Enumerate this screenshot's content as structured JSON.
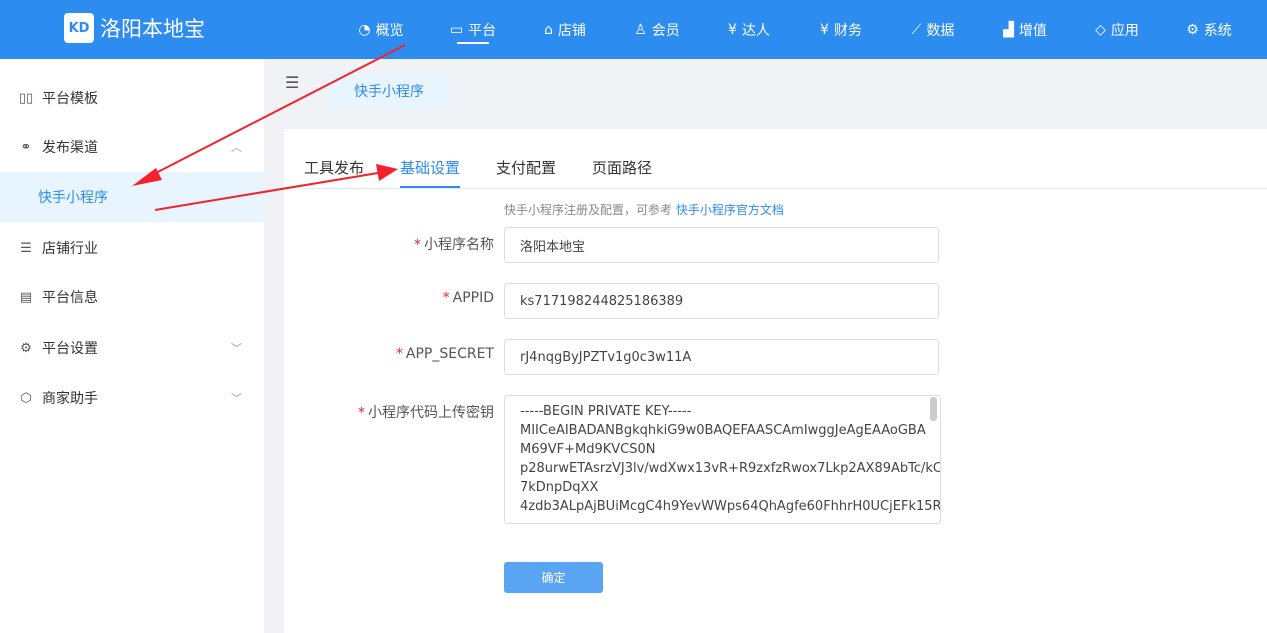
{
  "app": {
    "logo_mark": "KD",
    "title": "洛阳本地宝"
  },
  "nav": [
    {
      "label": "概览",
      "icon": "dashboard-icon"
    },
    {
      "label": "平台",
      "icon": "monitor-icon"
    },
    {
      "label": "店铺",
      "icon": "shop-icon"
    },
    {
      "label": "会员",
      "icon": "user-icon"
    },
    {
      "label": "达人",
      "icon": "yen-card-icon"
    },
    {
      "label": "财务",
      "icon": "finance-icon"
    },
    {
      "label": "数据",
      "icon": "line-chart-icon"
    },
    {
      "label": "增值",
      "icon": "growth-icon"
    },
    {
      "label": "应用",
      "icon": "cube-icon"
    },
    {
      "label": "系统",
      "icon": "gear-icon"
    }
  ],
  "sidebar": {
    "items": [
      {
        "label": "平台模板",
        "icon": "template-icon"
      },
      {
        "label": "发布渠道",
        "icon": "channel-icon"
      },
      {
        "label": "店铺行业",
        "icon": "list-icon"
      },
      {
        "label": "平台信息",
        "icon": "info-icon"
      },
      {
        "label": "平台设置",
        "icon": "settings-icon"
      },
      {
        "label": "商家助手",
        "icon": "helper-icon"
      }
    ],
    "sub_active": "快手小程序"
  },
  "page_tab": "快手小程序",
  "tabs": [
    "工具发布",
    "基础设置",
    "支付配置",
    "页面路径"
  ],
  "hint": {
    "text": "快手小程序注册及配置，可参考 ",
    "link": "快手小程序官方文档"
  },
  "form": {
    "name_label": "小程序名称",
    "name_value": "洛阳本地宝",
    "appid_label": "APPID",
    "appid_value": "ks717198244825186389",
    "secret_label": "APP_SECRET",
    "secret_value": "rJ4nqgByJPZTv1g0c3w11A",
    "key_label": "小程序代码上传密钥",
    "key_value": "-----BEGIN PRIVATE KEY-----\nMIICeAIBADANBgkqhkiG9w0BAQEFAASCAmIwggJeAgEAAoGBA\nM69VF+Md9KVCS0N\np28urwETAsrzVJ3lv/wdXwx13vR+R9zxfzRwox7Lkp2AX89AbTc/kCQ\n7kDnpDqXX\n4zdb3ALpAjBUiMcgC4h9YevWWps64QhAgfe60FhhrH0UCjEFk15R\n...",
    "submit_label": "确定"
  },
  "colors": {
    "primary": "#2d8cf0",
    "annotation": "#f5222d"
  }
}
